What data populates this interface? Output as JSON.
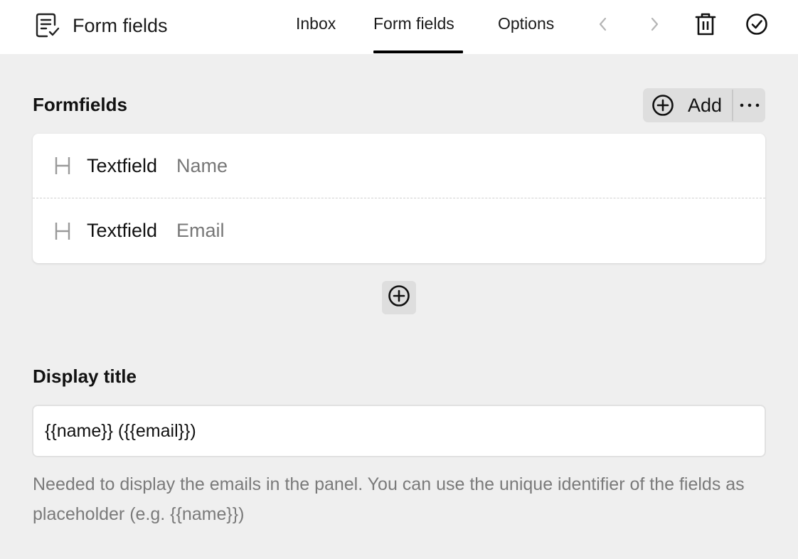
{
  "header": {
    "title": "Form fields",
    "title_icon": "form-checklist-icon",
    "tabs": [
      {
        "label": "Inbox",
        "active": false
      },
      {
        "label": "Form fields",
        "active": true
      },
      {
        "label": "Options",
        "active": false
      }
    ],
    "actions": [
      "chevron-left-icon",
      "chevron-right-icon",
      "trash-icon",
      "check-circle-icon"
    ]
  },
  "formfields": {
    "heading": "Formfields",
    "add_label": "Add",
    "fields": [
      {
        "type": "Textfield",
        "label": "Name",
        "icon": "heading-icon"
      },
      {
        "type": "Textfield",
        "label": "Email",
        "icon": "heading-icon"
      }
    ]
  },
  "display_title": {
    "heading": "Display title",
    "value": "{{name}} ({{email}})",
    "help": "Needed to display the emails in the panel. You can use the unique identifier of the fields as placeholder (e.g. {{name}})"
  },
  "colors": {
    "background": "#efefef",
    "surface": "#ffffff",
    "button_bg": "#dedede",
    "muted_text": "#777777",
    "active_underline": "#000000"
  }
}
